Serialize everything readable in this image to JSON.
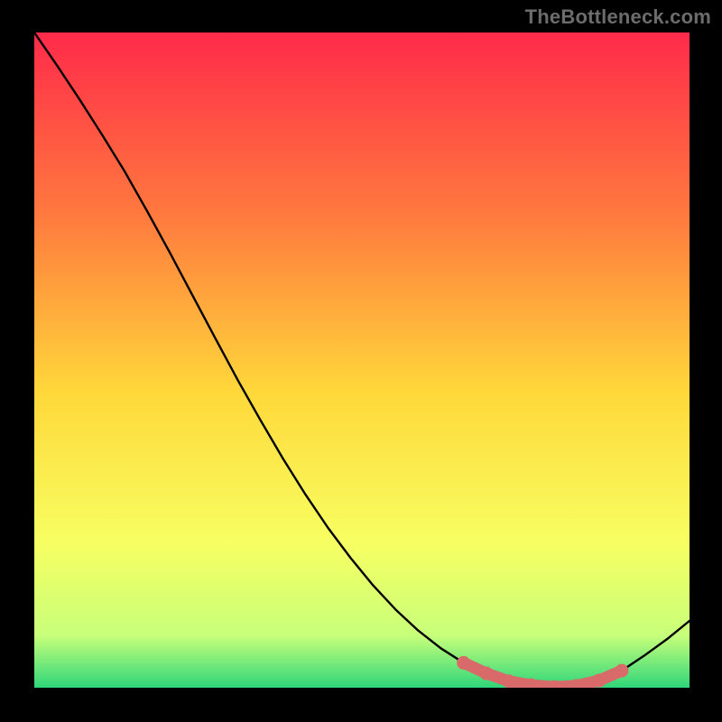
{
  "watermark": "TheBottleneck.com",
  "colors": {
    "frame": "#000000",
    "gradient_top": "#ff2a4a",
    "gradient_upper_mid": "#ff7a3e",
    "gradient_mid": "#ffd83a",
    "gradient_lower_mid": "#f7ff62",
    "gradient_near_bottom": "#c8ff7a",
    "gradient_bottom": "#2fd67a",
    "curve": "#000000",
    "highlight": "#d96a6a"
  },
  "chart_data": {
    "type": "line",
    "title": "",
    "xlabel": "",
    "ylabel": "",
    "xlim": [
      0,
      100
    ],
    "ylim": [
      0,
      100
    ],
    "series": [
      {
        "name": "curve",
        "x": [
          0,
          3.45,
          6.9,
          10.34,
          13.79,
          17.24,
          20.69,
          24.14,
          27.59,
          31.03,
          34.48,
          37.93,
          41.38,
          44.83,
          48.28,
          51.72,
          55.17,
          58.62,
          62.07,
          65.52,
          68.97,
          72.41,
          75.86,
          79.31,
          82.76,
          86.21,
          89.66,
          93.1,
          96.55,
          100
        ],
        "y": [
          100,
          95,
          89.8,
          84.4,
          78.8,
          72.7,
          66.4,
          59.9,
          53.4,
          47,
          40.9,
          35,
          29.5,
          24.4,
          19.8,
          15.6,
          11.9,
          8.7,
          6,
          3.8,
          2.2,
          1,
          0.4,
          0.1,
          0.3,
          1.1,
          2.6,
          4.9,
          7.4,
          10.2
        ]
      },
      {
        "name": "highlight-segment",
        "x": [
          65.52,
          68.97,
          72.41,
          75.86,
          79.31,
          82.76,
          86.21,
          89.66
        ],
        "y": [
          3.8,
          2.2,
          1.0,
          0.4,
          0.1,
          0.3,
          1.1,
          2.6
        ]
      }
    ]
  }
}
